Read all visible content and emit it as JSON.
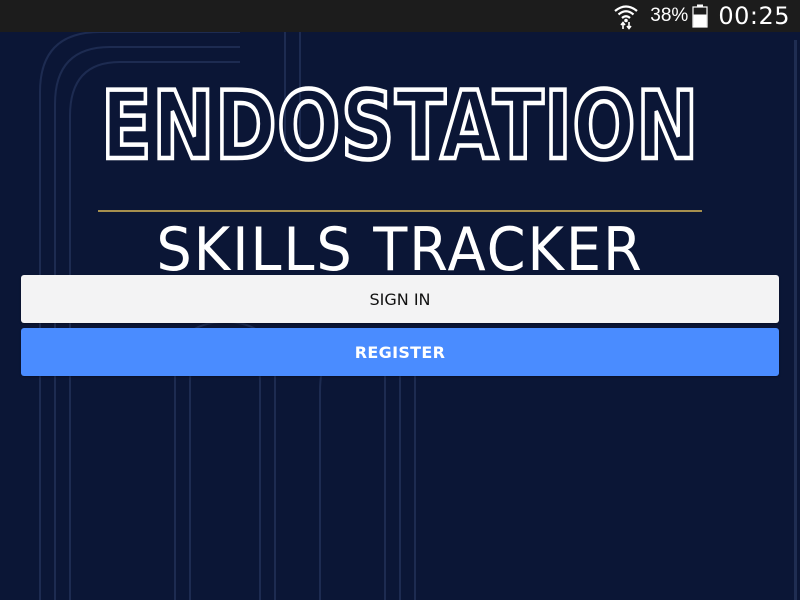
{
  "status_bar": {
    "battery_percent": "38%",
    "time": "00:25",
    "icons": [
      "wifi-icon",
      "battery-icon"
    ]
  },
  "logo": {
    "title": "ENDOSTATION",
    "subtitle": "SKILLS TRACKER",
    "rule_color": "#a68f4e"
  },
  "buttons": {
    "sign_in": "SIGN IN",
    "register": "REGISTER"
  },
  "colors": {
    "background": "#0b1636",
    "status_bar": "#1c1c1c",
    "sign_in_bg": "#f3f3f4",
    "register_bg": "#4a8cff"
  }
}
